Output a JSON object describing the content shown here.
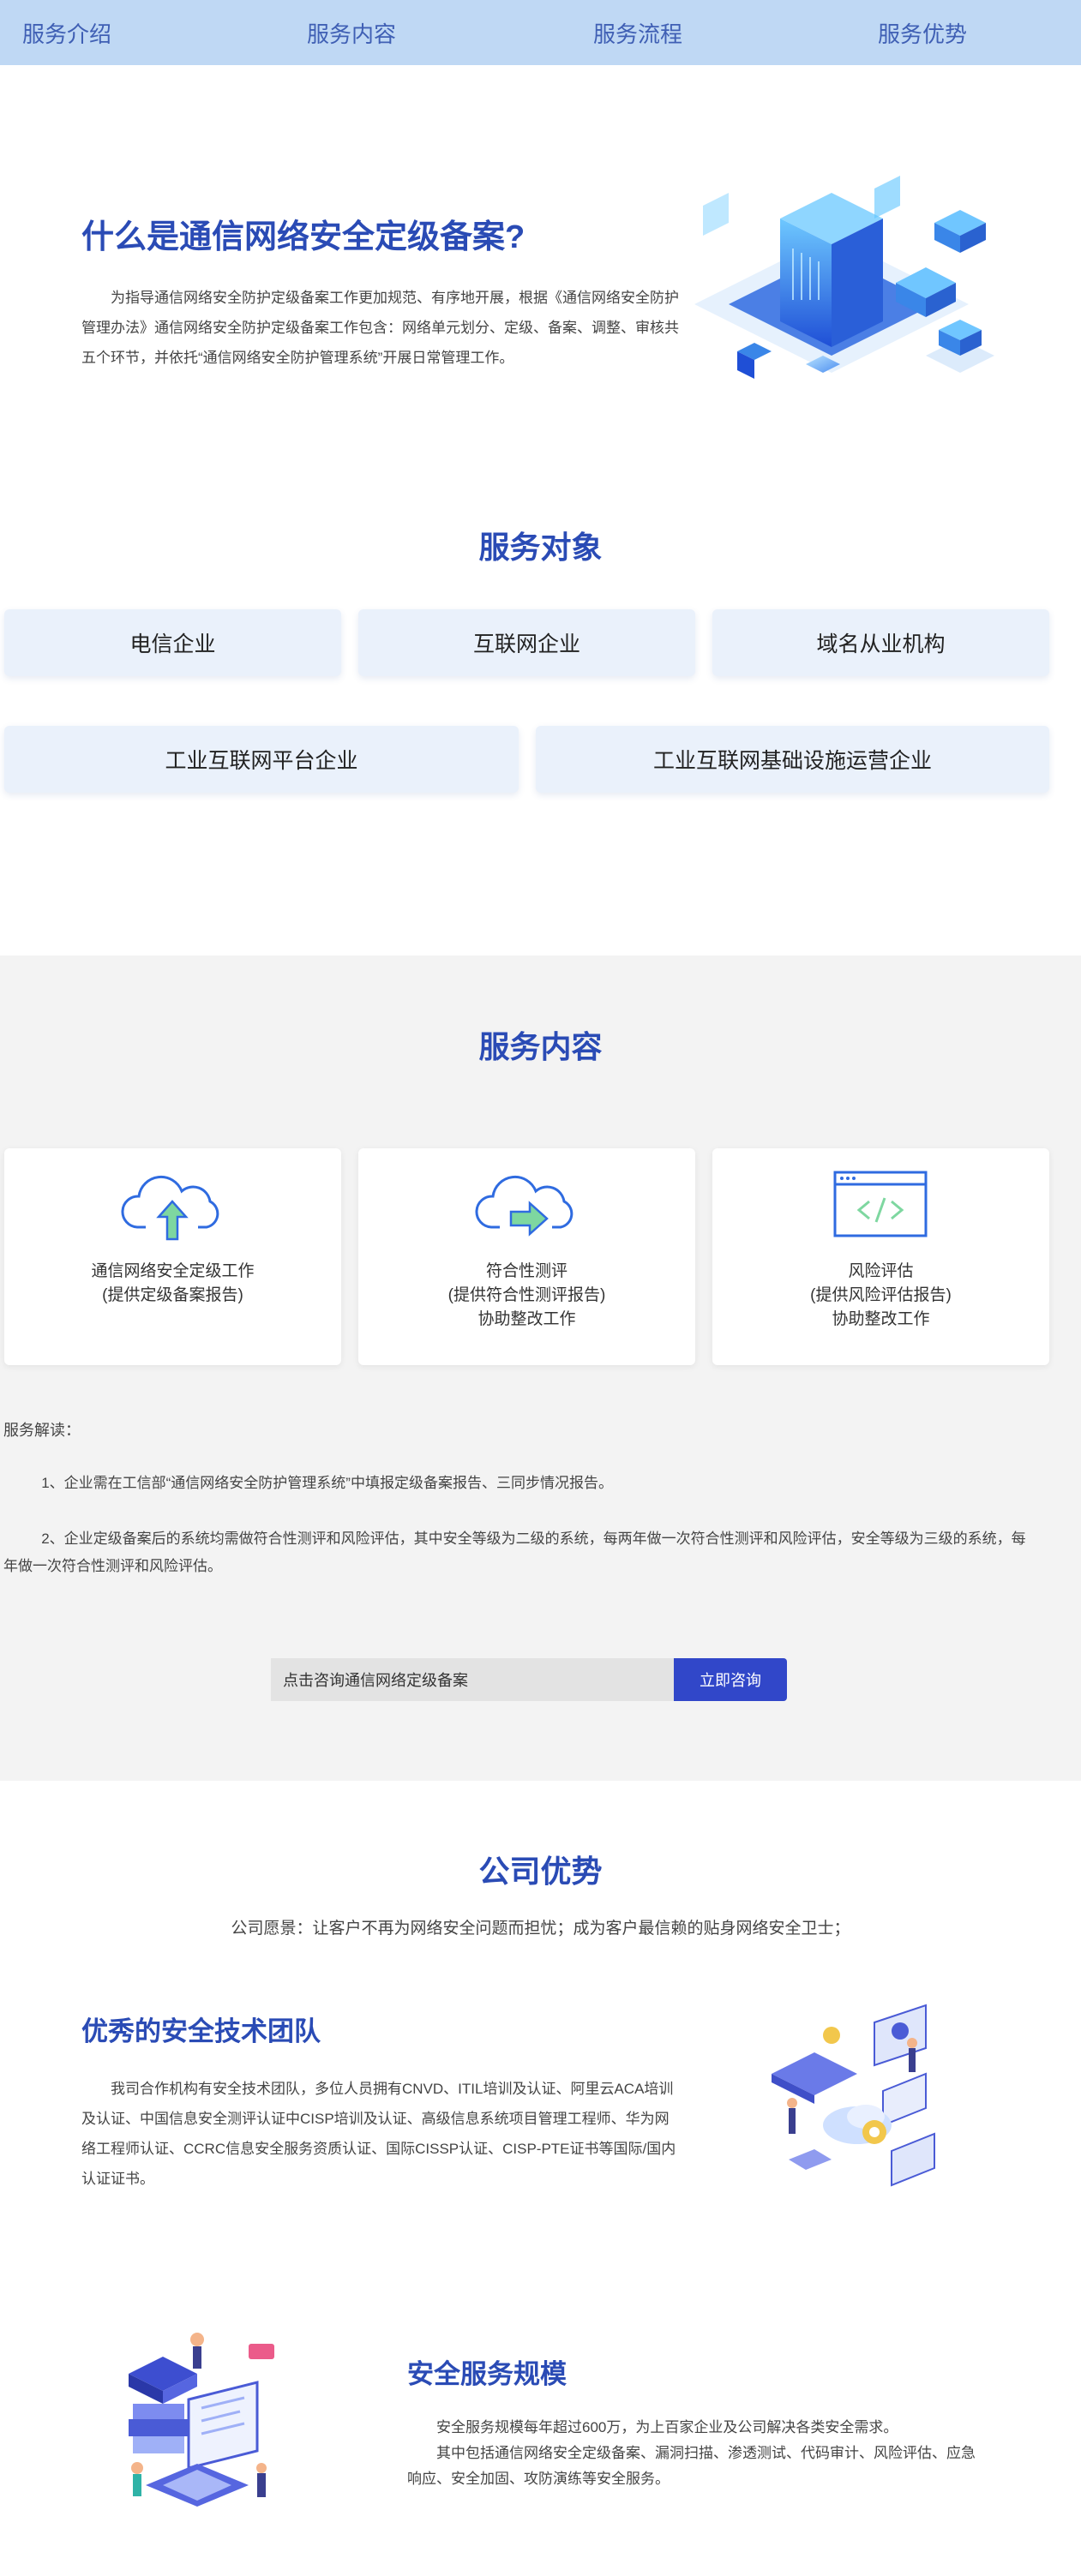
{
  "nav": {
    "items": [
      "服务介绍",
      "服务内容",
      "服务流程",
      "服务优势"
    ]
  },
  "intro": {
    "title": "什么是通信网络安全定级备案?",
    "text": "为指导通信网络安全防护定级备案工作更加规范、有序地开展，根据《通信网络安全防护管理办法》通信网络安全防护定级备案工作包含：网络单元划分、定级、备案、调整、审核共五个环节，并依托“通信网络安全防护管理系统”开展日常管理工作。"
  },
  "targets": {
    "title": "服务对象",
    "row1": [
      "电信企业",
      "互联网企业",
      "域名从业机构"
    ],
    "row2": [
      "工业互联网平台企业",
      "工业互联网基础设施运营企业"
    ]
  },
  "content": {
    "title": "服务内容",
    "cards": [
      {
        "icon": "cloud-upload-icon",
        "lines": [
          "通信网络安全定级工作",
          "(提供定级备案报告)"
        ]
      },
      {
        "icon": "cloud-transfer-icon",
        "lines": [
          "符合性测评",
          "(提供符合性测评报告)",
          "协助整改工作"
        ]
      },
      {
        "icon": "code-window-icon",
        "lines": [
          "风险评估",
          "(提供风险评估报告)",
          "协助整改工作"
        ]
      }
    ],
    "interp_label": "服务解读：",
    "interp": [
      "1、企业需在工信部“通信网络安全防护管理系统”中填报定级备案报告、三同步情况报告。",
      "2、企业定级备案后的系统均需做符合性测评和风险评估，其中安全等级为二级的系统，每两年做一次符合性测评和风险评估，安全等级为三级的系统，每年做一次符合性测评和风险评估。"
    ],
    "consult_placeholder": "点击咨询通信网络定级备案",
    "consult_button": "立即咨询"
  },
  "advantage": {
    "title": "公司优势",
    "vision": "公司愿景：让客户不再为网络安全问题而担忧；成为客户最信赖的贴身网络安全卫士；",
    "blocks": [
      {
        "title": "优秀的安全技术团队",
        "text": "我司合作机构有安全技术团队，多位人员拥有CNVD、ITIL培训及认证、阿里云ACA培训及认证、中国信息安全测评认证中CISP培训及认证、高级信息系统项目管理工程师、华为网络工程师认证、CCRC信息安全服务资质认证、国际CISSP认证、CISP-PTE证书等国际/国内认证证书。"
      },
      {
        "title": "安全服务规模",
        "text1": "安全服务规模每年超过600万，为上百家企业及公司解决各类安全需求。",
        "text2": "其中包括通信网络安全定级备案、漏洞扫描、渗透测试、代码审计、风险评估、应急响应、安全加固、攻防演练等安全服务。"
      }
    ]
  },
  "colors": {
    "nav_bg": "#bfd8f4",
    "accent": "#2a4bb5",
    "button": "#3147c9",
    "card_bg": "#eaf1fb",
    "section_gray": "#f3f3f3"
  }
}
